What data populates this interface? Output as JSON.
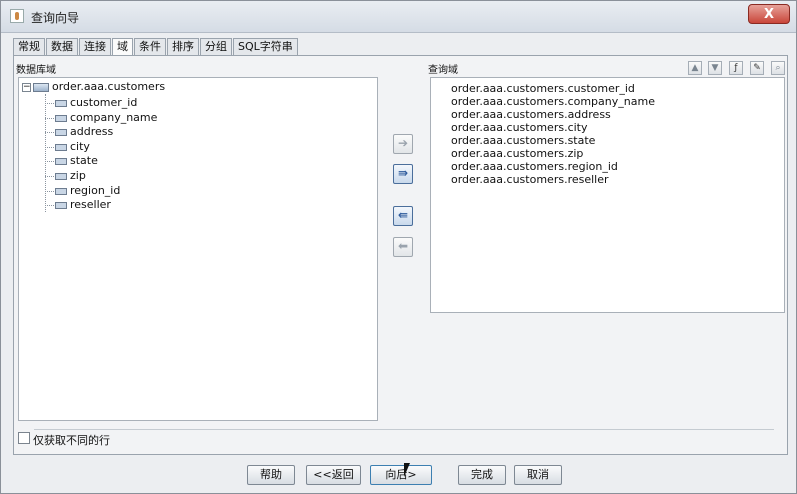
{
  "window": {
    "title": "查询向导",
    "close_label": "X"
  },
  "tabs": [
    {
      "label": "常规"
    },
    {
      "label": "数据"
    },
    {
      "label": "连接"
    },
    {
      "label": "域",
      "active": true
    },
    {
      "label": "条件"
    },
    {
      "label": "排序"
    },
    {
      "label": "分组"
    },
    {
      "label": "SQL字符串"
    }
  ],
  "left_panel": {
    "label": "数据库域",
    "table": "order.aaa.customers",
    "expander": "−",
    "fields": [
      "customer_id",
      "company_name",
      "address",
      "city",
      "state",
      "zip",
      "region_id",
      "reseller"
    ]
  },
  "right_panel": {
    "label": "查询域",
    "fields": [
      "order.aaa.customers.customer_id",
      "order.aaa.customers.company_name",
      "order.aaa.customers.address",
      "order.aaa.customers.city",
      "order.aaa.customers.state",
      "order.aaa.customers.zip",
      "order.aaa.customers.region_id",
      "order.aaa.customers.reseller"
    ],
    "toolbar_icons": [
      "move-up-icon",
      "move-down-icon",
      "function-icon",
      "edit-icon",
      "search-icon"
    ]
  },
  "transfer_buttons": [
    {
      "glyph": "➔",
      "icon": "add-one-icon",
      "enabled": false
    },
    {
      "glyph": "⇛",
      "icon": "add-all-icon",
      "enabled": true
    },
    {
      "glyph": "⇚",
      "icon": "remove-all-icon",
      "enabled": true
    },
    {
      "glyph": "⬅",
      "icon": "remove-one-icon",
      "enabled": false
    }
  ],
  "distinct": {
    "label": "仅获取不同的行",
    "checked": false
  },
  "buttons": {
    "help": "帮助",
    "back": "<<返回",
    "next": "向后>",
    "finish": "完成",
    "cancel": "取消"
  },
  "colors": {
    "accent": "#2d5a9c",
    "close": "#c9463a"
  }
}
